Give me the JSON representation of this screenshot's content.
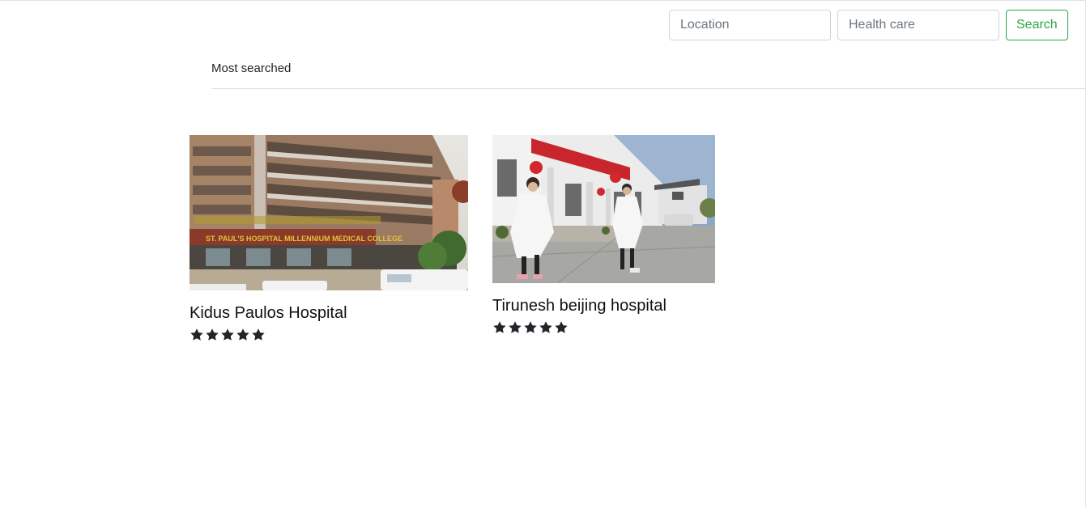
{
  "search": {
    "location_placeholder": "Location",
    "healthcare_placeholder": "Health care",
    "button_label": "Search"
  },
  "tabs": {
    "most_searched": "Most searched"
  },
  "hospitals": [
    {
      "name": "Kidus Paulos Hospital",
      "rating": 5,
      "sign_text": "ST. PAUL'S HOSPITAL MILLENNIUM MEDICAL COLLEGE"
    },
    {
      "name": "Tirunesh beijing hospital",
      "rating": 5
    }
  ],
  "colors": {
    "accent": "#28a745",
    "star": "#212529",
    "border": "#dee2e6"
  }
}
